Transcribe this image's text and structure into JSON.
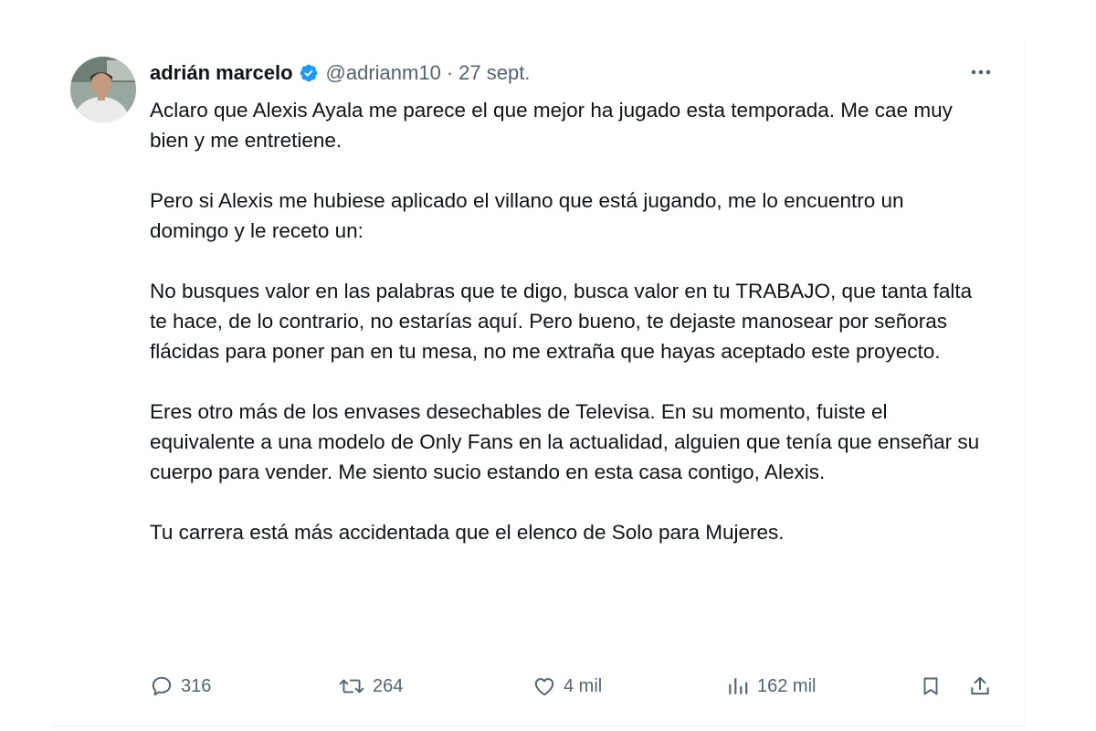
{
  "author": {
    "name": "adrián marcelo",
    "handle": "@adrianm10",
    "separator": "·",
    "date": "27 sept."
  },
  "tweet": {
    "paragraphs": [
      "Aclaro que Alexis Ayala me parece el que mejor ha jugado esta temporada. Me cae muy bien y me entretiene.",
      "Pero si Alexis me hubiese aplicado el villano que está jugando, me lo encuentro un domingo y le receto un:",
      "No busques valor en las palabras que te digo, busca valor en tu TRABAJO, que tanta falta te hace, de lo contrario, no estarías aquí. Pero bueno, te dejaste manosear por señoras flácidas para poner pan en tu mesa, no me extraña que hayas aceptado este proyecto.",
      "Eres otro más de los envases desechables de Televisa. En su momento, fuiste el equivalente a una modelo de Only Fans en la actualidad, alguien que tenía que enseñar su cuerpo para vender. Me siento sucio estando en esta casa contigo, Alexis.",
      "Tu carrera está más accidentada que el elenco de Solo para Mujeres."
    ]
  },
  "stats": {
    "replies": "316",
    "retweets": "264",
    "likes": "4 mil",
    "views": "162 mil"
  },
  "icons": {
    "verified": "verified-badge-icon",
    "more": "more-dots-icon",
    "reply": "reply-icon",
    "retweet": "retweet-icon",
    "like": "heart-icon",
    "views": "views-bar-chart-icon",
    "bookmark": "bookmark-icon",
    "share": "share-icon"
  },
  "colors": {
    "text": "#0f1419",
    "secondary": "#536471",
    "verified": "#1d9bf0"
  }
}
